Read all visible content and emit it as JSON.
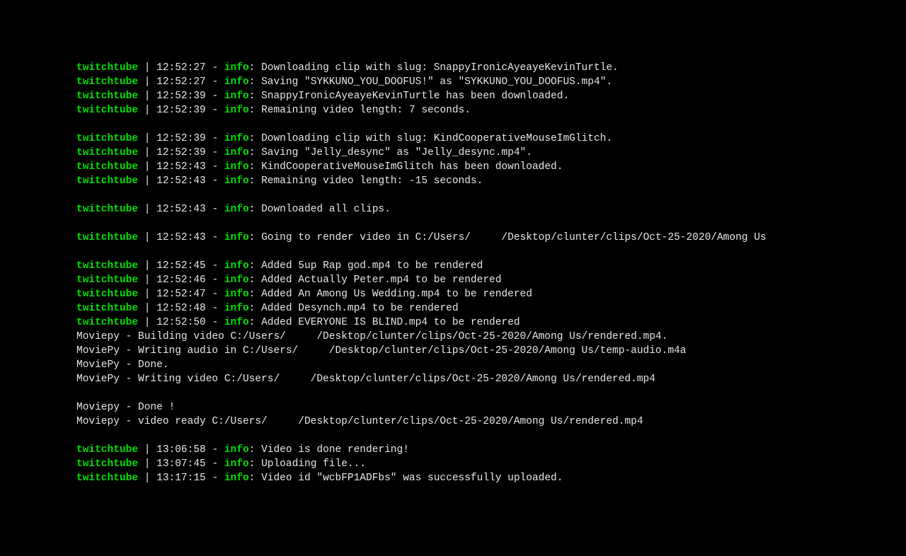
{
  "logger_name": "twitchtube",
  "level_label": "info",
  "lines": [
    {
      "type": "log",
      "time": "12:52:27",
      "msg": "Downloading clip with slug: SnappyIronicAyeayeKevinTurtle."
    },
    {
      "type": "log",
      "time": "12:52:27",
      "msg": "Saving \"SYKKUNO_YOU_DOOFUS!\" as \"SYKKUNO_YOU_DOOFUS.mp4\"."
    },
    {
      "type": "log",
      "time": "12:52:39",
      "msg": "SnappyIronicAyeayeKevinTurtle has been downloaded."
    },
    {
      "type": "log",
      "time": "12:52:39",
      "msg": "Remaining video length: 7 seconds."
    },
    {
      "type": "blank"
    },
    {
      "type": "log",
      "time": "12:52:39",
      "msg": "Downloading clip with slug: KindCooperativeMouseImGlitch."
    },
    {
      "type": "log",
      "time": "12:52:39",
      "msg": "Saving \"Jelly_desync\" as \"Jelly_desync.mp4\"."
    },
    {
      "type": "log",
      "time": "12:52:43",
      "msg": "KindCooperativeMouseImGlitch has been downloaded."
    },
    {
      "type": "log",
      "time": "12:52:43",
      "msg": "Remaining video length: -15 seconds."
    },
    {
      "type": "blank"
    },
    {
      "type": "log",
      "time": "12:52:43",
      "msg": "Downloaded all clips."
    },
    {
      "type": "blank"
    },
    {
      "type": "log",
      "time": "12:52:43",
      "msg": "Going to render video in C:/Users/     /Desktop/clunter/clips/Oct-25-2020/Among Us"
    },
    {
      "type": "blank"
    },
    {
      "type": "log",
      "time": "12:52:45",
      "msg": "Added 5up Rap god.mp4 to be rendered"
    },
    {
      "type": "log",
      "time": "12:52:46",
      "msg": "Added Actually Peter.mp4 to be rendered"
    },
    {
      "type": "log",
      "time": "12:52:47",
      "msg": "Added An Among Us Wedding.mp4 to be rendered"
    },
    {
      "type": "log",
      "time": "12:52:48",
      "msg": "Added Desynch.mp4 to be rendered"
    },
    {
      "type": "log",
      "time": "12:52:50",
      "msg": "Added EVERYONE IS BLIND.mp4 to be rendered"
    },
    {
      "type": "plain",
      "text": "Moviepy - Building video C:/Users/     /Desktop/clunter/clips/Oct-25-2020/Among Us/rendered.mp4."
    },
    {
      "type": "plain",
      "text": "MoviePy - Writing audio in C:/Users/     /Desktop/clunter/clips/Oct-25-2020/Among Us/temp-audio.m4a"
    },
    {
      "type": "plain",
      "text": "MoviePy - Done."
    },
    {
      "type": "plain",
      "text": "MoviePy - Writing video C:/Users/     /Desktop/clunter/clips/Oct-25-2020/Among Us/rendered.mp4"
    },
    {
      "type": "blank"
    },
    {
      "type": "plain",
      "text": "Moviepy - Done !"
    },
    {
      "type": "plain",
      "text": "Moviepy - video ready C:/Users/     /Desktop/clunter/clips/Oct-25-2020/Among Us/rendered.mp4"
    },
    {
      "type": "blank"
    },
    {
      "type": "log",
      "time": "13:06:58",
      "msg": "Video is done rendering!"
    },
    {
      "type": "log",
      "time": "13:07:45",
      "msg": "Uploading file..."
    },
    {
      "type": "log",
      "time": "13:17:15",
      "msg": "Video id \"wcbFP1ADFbs\" was successfully uploaded."
    }
  ]
}
